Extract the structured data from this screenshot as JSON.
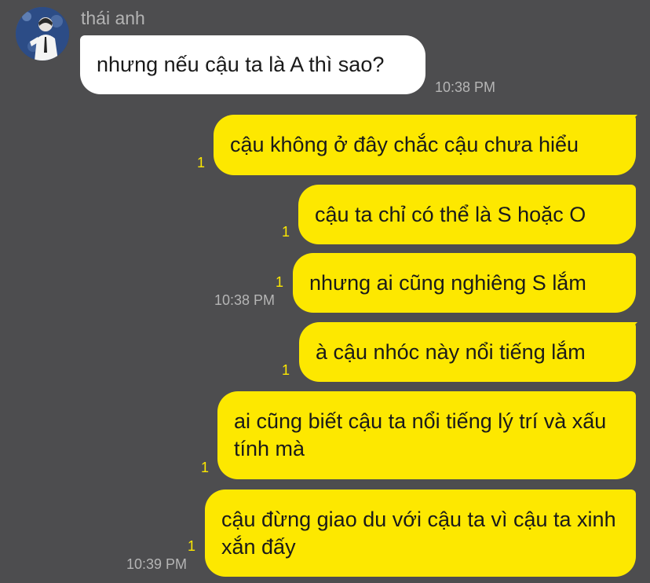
{
  "chat": {
    "sender": "thái anh",
    "incoming": [
      {
        "text": "nhưng nếu cậu ta là A thì sao?",
        "time": "10:38 PM"
      }
    ],
    "outgoing": [
      {
        "text": "cậu không ở đây chắc cậu chưa hiểu",
        "unread": "1",
        "time": ""
      },
      {
        "text": "cậu ta chỉ có thể là S hoặc O",
        "unread": "1",
        "time": ""
      },
      {
        "text": "nhưng ai cũng nghiêng S lắm",
        "unread": "1",
        "time": "10:38 PM"
      },
      {
        "text": "à cậu nhóc này nổi tiếng lắm",
        "unread": "1",
        "time": ""
      },
      {
        "text": "ai cũng biết cậu ta nổi tiếng lý trí và xấu tính mà",
        "unread": "1",
        "time": ""
      },
      {
        "text": "cậu đừng giao du với cậu ta vì cậu ta xinh xắn đấy",
        "unread": "1",
        "time": "10:39 PM"
      }
    ]
  },
  "colors": {
    "background": "#4d4d4f",
    "outgoing_bubble": "#fde800",
    "incoming_bubble": "#ffffff",
    "unread_count": "#fde800"
  }
}
